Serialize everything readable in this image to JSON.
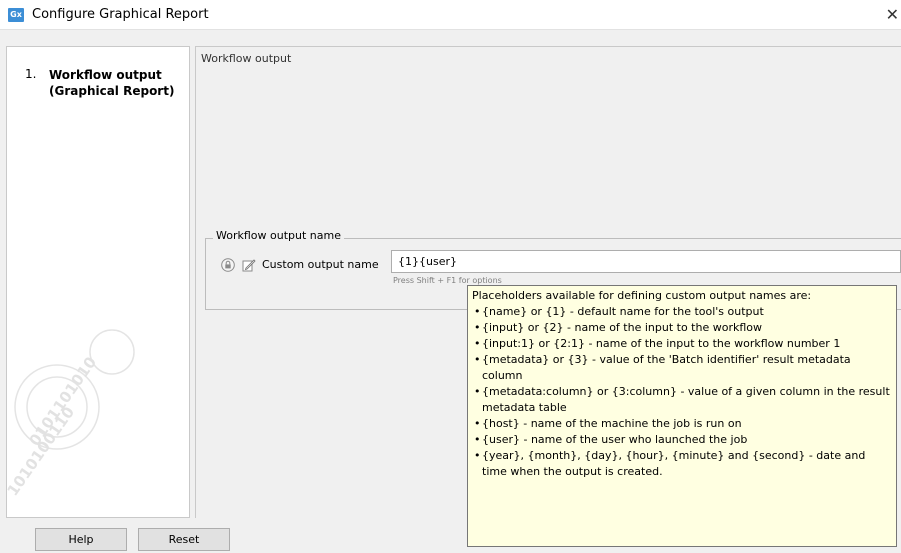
{
  "window": {
    "app_icon": "Gx",
    "title": "Configure Graphical Report",
    "close_glyph": "✕"
  },
  "steps": [
    {
      "number": "1.",
      "label": "Workflow output (Graphical Report)"
    }
  ],
  "main": {
    "section_title": "Workflow output",
    "fieldset_legend": "Workflow output name",
    "field_label": "Custom output name",
    "field_value": "{1}{user}",
    "field_hint": "Press Shift + F1 for options"
  },
  "tooltip": {
    "heading": "Placeholders available for defining custom output names are:",
    "items": [
      "{name} or {1} - default name for the tool's output",
      "{input} or {2} - name of the input to the workflow",
      "{input:1} or {2:1} - name of the input to the workflow number 1",
      "{metadata} or {3} - value of the 'Batch identifier' result metadata column",
      "{metadata:column} or {3:column} - value of a given column in the result metadata table",
      "{host} - name of the machine the job is run on",
      "{user} - name of the user who launched the job",
      "{year}, {month}, {day}, {hour}, {minute} and {second} - date and time when the output is created."
    ]
  },
  "buttons": {
    "help": "Help",
    "reset": "Reset"
  },
  "icons": {
    "app": "app-icon",
    "close": "close-icon",
    "lock": "lock-icon",
    "edit": "edit-icon",
    "watermark": "watermark-logo"
  }
}
